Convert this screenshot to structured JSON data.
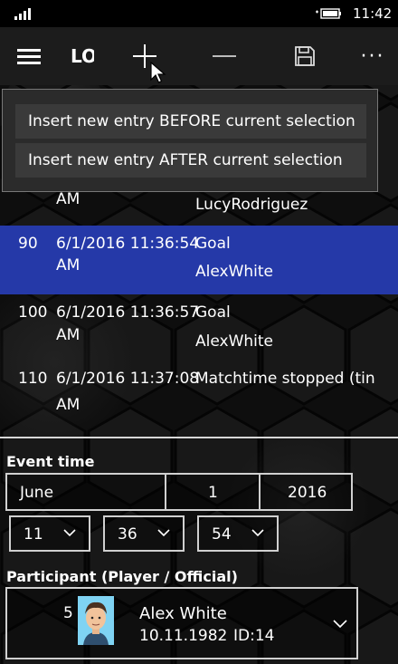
{
  "status": {
    "time": "11:42"
  },
  "appbar": {
    "title": "LO"
  },
  "flyout": {
    "items": [
      "Insert new entry BEFORE current selection",
      "Insert new entry AFTER current selection"
    ]
  },
  "entries": [
    {
      "num": "",
      "time": "",
      "ampm": "AM",
      "type": "",
      "name": "LucyRodriguez"
    },
    {
      "num": "90",
      "time": "6/1/2016 11:36:54",
      "ampm": "AM",
      "type": "Goal",
      "name": "AlexWhite",
      "selected": true
    },
    {
      "num": "100",
      "time": "6/1/2016 11:36:57",
      "ampm": "AM",
      "type": "Goal",
      "name": "AlexWhite"
    },
    {
      "num": "110",
      "time": "6/1/2016 11:37:08",
      "ampm": "AM",
      "type": "Matchtime stopped (tin",
      "name": ""
    }
  ],
  "event_time": {
    "label": "Event time",
    "month": "June",
    "day": "1",
    "year": "2016",
    "hour": "11",
    "minute": "36",
    "second": "54"
  },
  "participant": {
    "label": "Participant (Player / Official)",
    "number": "5",
    "name": "Alex White",
    "dob": "10.11.1982",
    "id": "ID:14"
  },
  "colors": {
    "selection": "#2539a8",
    "appbar": "#1c1c1c"
  }
}
